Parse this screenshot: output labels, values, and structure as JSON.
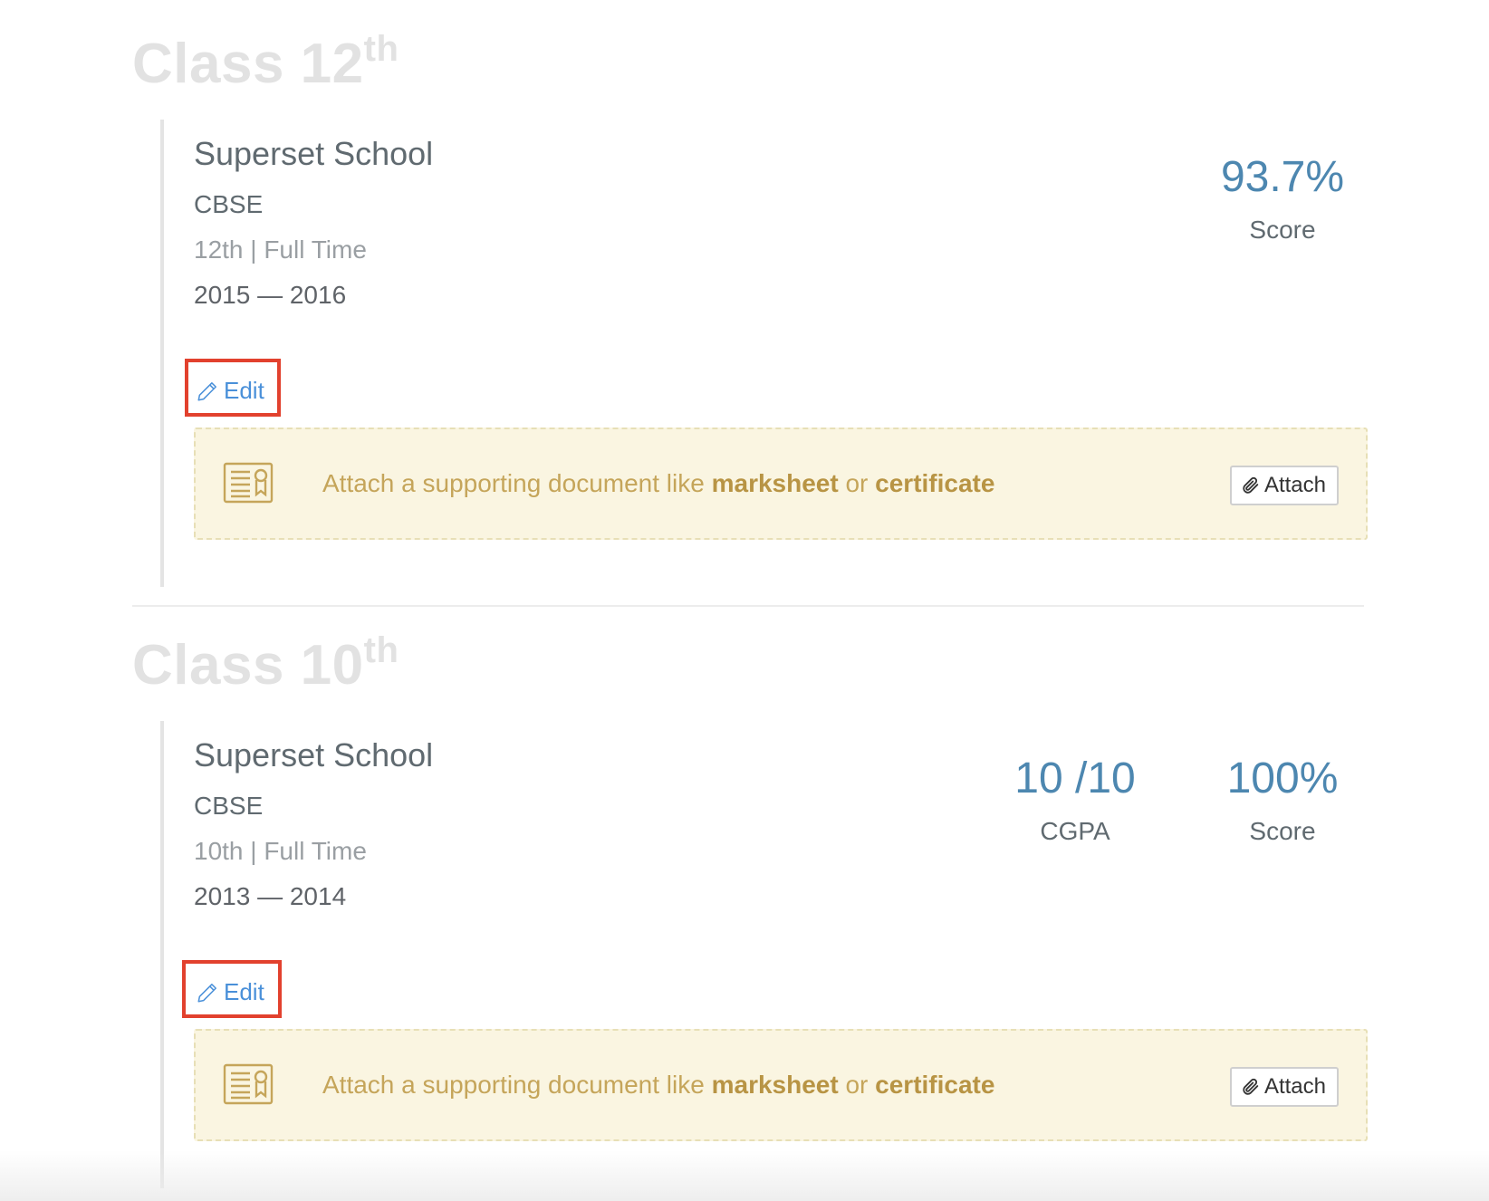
{
  "sections": [
    {
      "heading": {
        "text": "Class 12",
        "sup": "th"
      },
      "school": "Superset School",
      "board": "CBSE",
      "mode": "12th | Full Time",
      "years": "2015 — 2016",
      "edit_label": "Edit",
      "attach": {
        "text_prefix": "Attach a supporting document like ",
        "bold1": "marksheet",
        "middle": " or ",
        "bold2": "certificate",
        "button_label": "Attach"
      },
      "metrics": [
        {
          "value": "93.7%",
          "label": "Score"
        }
      ]
    },
    {
      "heading": {
        "text": "Class 10",
        "sup": "th"
      },
      "school": "Superset School",
      "board": "CBSE",
      "mode": "10th | Full Time",
      "years": "2013 — 2014",
      "edit_label": "Edit",
      "attach": {
        "text_prefix": "Attach a supporting document like ",
        "bold1": "marksheet",
        "middle": " or ",
        "bold2": "certificate",
        "button_label": "Attach"
      },
      "metrics": [
        {
          "value": "10 /10",
          "label": "CGPA"
        },
        {
          "value": "100%",
          "label": "Score"
        }
      ]
    }
  ],
  "colors": {
    "heading": "#e2e2e2",
    "metric_value": "#4d87b0",
    "edit_link": "#4a90d9",
    "highlight_box": "#e2412e",
    "attach_bg": "#faf5e1",
    "attach_text": "#c5a55a"
  },
  "icons": {
    "edit": "pencil-icon",
    "document": "certificate-document-icon",
    "attach": "paperclip-icon"
  }
}
